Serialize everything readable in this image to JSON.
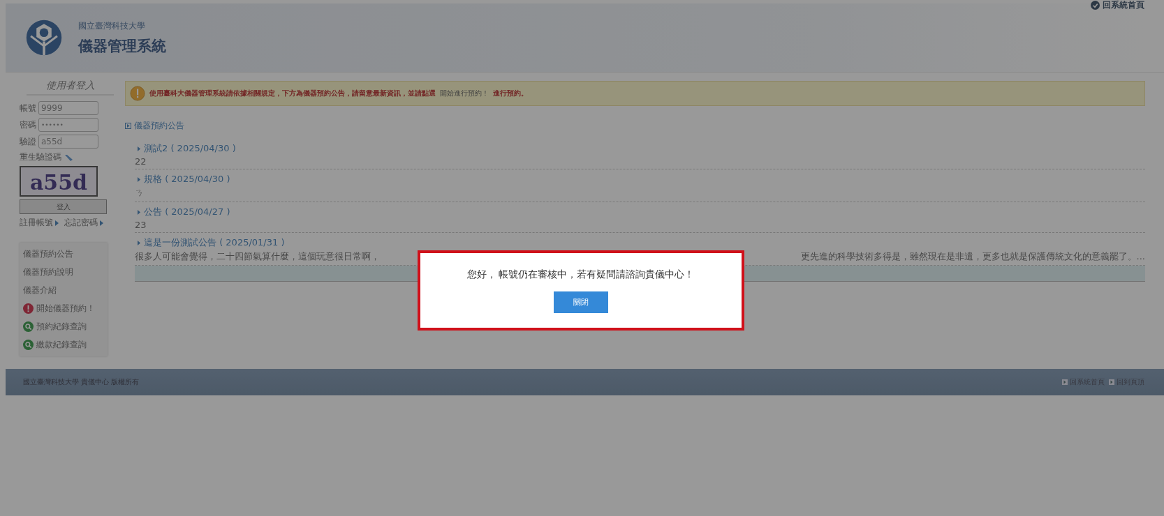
{
  "header": {
    "org": "國立臺灣科技大學",
    "title": "儀器管理系統",
    "home_link": "回系統首頁"
  },
  "login": {
    "heading": "使用者登入",
    "fields": [
      {
        "label": "帳號",
        "value": "9999",
        "kind": "text"
      },
      {
        "label": "密碼",
        "value": "••••••",
        "kind": "password"
      },
      {
        "label": "驗證",
        "value": "a55d",
        "kind": "text"
      }
    ],
    "refresh_captcha": "重生驗證碼",
    "captcha_text": "a55d",
    "submit": "登入",
    "links": [
      "註冊帳號",
      "忘記密碼"
    ]
  },
  "sidebar": {
    "items": [
      {
        "label": "儀器預約公告",
        "kind": "plain"
      },
      {
        "label": "儀器預約說明",
        "kind": "plain"
      },
      {
        "label": "儀器介紹",
        "kind": "plain"
      },
      {
        "label": "開始儀器預約！",
        "kind": "alert"
      },
      {
        "label": "預約紀錄查詢",
        "kind": "search"
      },
      {
        "label": "繳款紀錄查詢",
        "kind": "search"
      }
    ]
  },
  "notice": {
    "text": "使用臺科大儀器管理系統請依據相關規定，下方為儀器預約公告，請留意最新資訊，並請點選",
    "hint": "開始進行預約！",
    "link": "進行預約。"
  },
  "announcements": {
    "heading": "儀器預約公告",
    "items": [
      {
        "title": "測試2 ( 2025/04/30 )",
        "body": "22"
      },
      {
        "title": "規格 ( 2025/04/30 )",
        "body": "ㄋ"
      },
      {
        "title": "公告 ( 2025/04/27 )",
        "body": "23"
      },
      {
        "title": "這是一份測試公告 ( 2025/01/31 )",
        "body": "很多人可能會覺得，二十四節氣算什麼，這個玩意很日常啊，",
        "body_end": "更先進的科學技術多得是，雖然現在是非遺，更多也就是保護傳統文化的意義罷了。..."
      }
    ]
  },
  "footer": {
    "copyright": "國立臺灣科技大學 貴儀中心 版權所有",
    "links": [
      "回系統首頁",
      "回到頁頂"
    ]
  },
  "dialog": {
    "message": "您好， 帳號仍在審核中，若有疑問請諮詢貴儀中心！",
    "button": "關閉"
  }
}
